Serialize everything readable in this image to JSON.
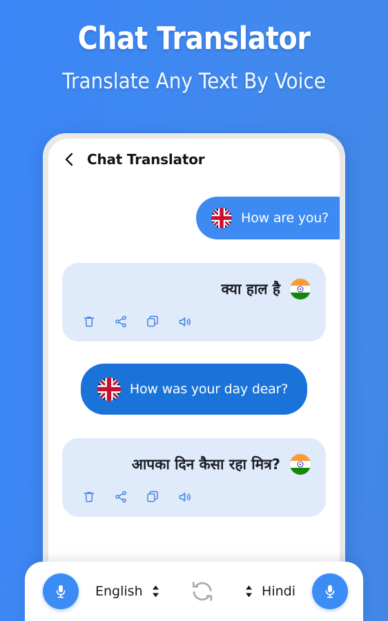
{
  "promo": {
    "title": "Chat Translator",
    "subtitle": "Translate Any Text By Voice"
  },
  "app": {
    "header": {
      "back_icon": "chevron-left-icon",
      "title": "Chat Translator"
    },
    "messages": [
      {
        "role": "source",
        "text": "How are you?",
        "flag": "uk-flag",
        "lang": "English"
      },
      {
        "role": "target",
        "text": "क्या हाल है",
        "flag": "india-flag",
        "lang": "Hindi",
        "actions": [
          "delete-icon",
          "share-icon",
          "copy-icon",
          "speaker-icon"
        ]
      },
      {
        "role": "source",
        "text": "How was your day dear?",
        "flag": "uk-flag",
        "lang": "English"
      },
      {
        "role": "target",
        "text": "आपका दिन कैसा रहा मित्र?",
        "flag": "india-flag",
        "lang": "Hindi",
        "actions": [
          "delete-icon",
          "share-icon",
          "copy-icon",
          "speaker-icon"
        ]
      }
    ],
    "bottom_bar": {
      "mic_left_icon": "microphone-icon",
      "source_language": "English",
      "swap_icon": "swap-languages-icon",
      "target_language": "Hindi",
      "mic_right_icon": "microphone-icon",
      "stepper_icon": "up-down-arrows-icon"
    }
  },
  "colors": {
    "background_blue": "#3b86f7",
    "bubble_source_light": "#3d8bf2",
    "bubble_source_dark": "#1a73d9",
    "bubble_target": "#dfeafb",
    "accent": "#3b8cf5",
    "icon_blue": "#3b7fe0",
    "swap_gray": "#a9aeb4"
  }
}
